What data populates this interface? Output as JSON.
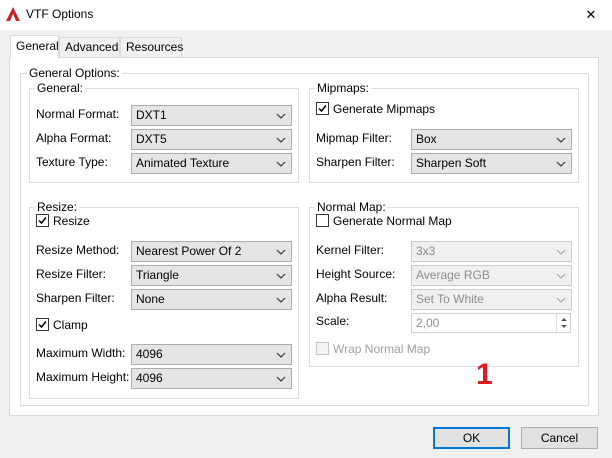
{
  "window": {
    "title": "VTF Options",
    "close_glyph": "✕"
  },
  "tabs": [
    {
      "label": "General",
      "active": true
    },
    {
      "label": "Advanced",
      "active": false
    },
    {
      "label": "Resources",
      "active": false
    }
  ],
  "general_options": {
    "label": "General Options:",
    "general": {
      "label": "General:",
      "normal_format": {
        "label": "Normal Format:",
        "value": "DXT1"
      },
      "alpha_format": {
        "label": "Alpha Format:",
        "value": "DXT5"
      },
      "texture_type": {
        "label": "Texture Type:",
        "value": "Animated Texture"
      }
    },
    "mipmaps": {
      "label": "Mipmaps:",
      "generate": {
        "label": "Generate Mipmaps",
        "checked": true
      },
      "filter": {
        "label": "Mipmap Filter:",
        "value": "Box"
      },
      "sharpen": {
        "label": "Sharpen Filter:",
        "value": "Sharpen Soft"
      }
    },
    "resize": {
      "label": "Resize:",
      "resize_check": {
        "label": "Resize",
        "checked": true
      },
      "method": {
        "label": "Resize Method:",
        "value": "Nearest Power Of 2"
      },
      "filter": {
        "label": "Resize Filter:",
        "value": "Triangle"
      },
      "sharpen": {
        "label": "Sharpen Filter:",
        "value": "None"
      },
      "clamp": {
        "label": "Clamp",
        "checked": true
      },
      "max_width": {
        "label": "Maximum Width:",
        "value": "4096"
      },
      "max_height": {
        "label": "Maximum Height:",
        "value": "4096"
      }
    },
    "normal_map": {
      "label": "Normal Map:",
      "generate": {
        "label": "Generate Normal Map",
        "checked": false
      },
      "kernel": {
        "label": "Kernel Filter:",
        "value": "3x3"
      },
      "height_source": {
        "label": "Height Source:",
        "value": "Average RGB"
      },
      "alpha_result": {
        "label": "Alpha Result:",
        "value": "Set To White"
      },
      "scale": {
        "label": "Scale:",
        "value": "2,00"
      },
      "wrap": {
        "label": "Wrap Normal Map",
        "checked": false
      }
    }
  },
  "annotation": "1",
  "buttons": {
    "ok": "OK",
    "cancel": "Cancel"
  },
  "colors": {
    "accent": "#0078d7",
    "annotation": "#e01b24"
  }
}
